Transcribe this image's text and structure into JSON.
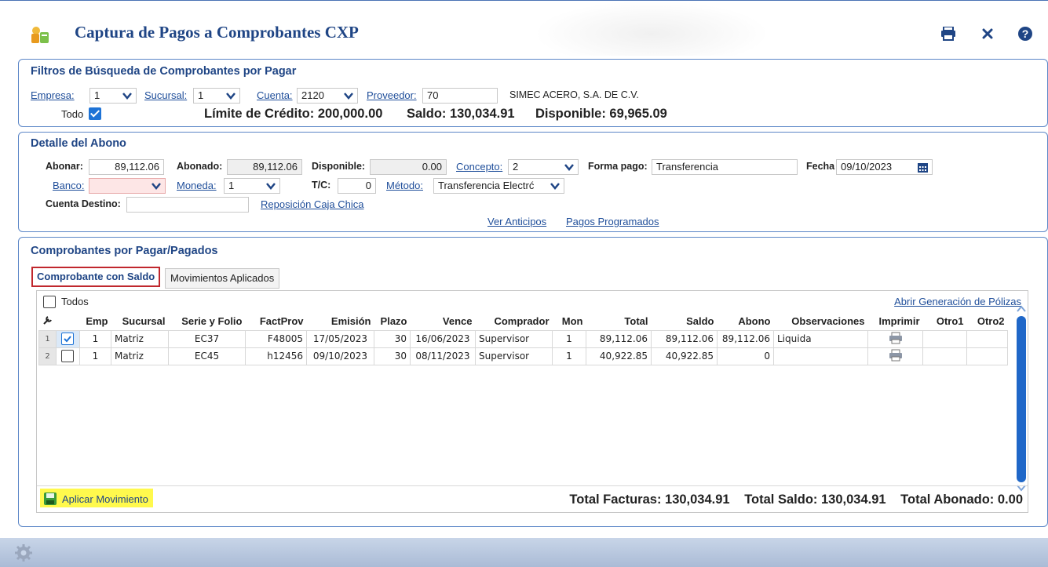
{
  "header": {
    "title": "Captura de Pagos a Comprobantes CXP",
    "actions": [
      "print-icon",
      "close-icon",
      "help-icon"
    ]
  },
  "filters": {
    "title": "Filtros de Búsqueda de Comprobantes por Pagar",
    "empresa_label": "Empresa:",
    "empresa_value": "1",
    "sucursal_label": "Sucursal:",
    "sucursal_value": "1",
    "cuenta_label": "Cuenta:",
    "cuenta_value": "2120",
    "proveedor_label": "Proveedor:",
    "proveedor_value": "70",
    "proveedor_name": "SIMEC ACERO, S.A. DE C.V.",
    "todo_label": "Todo",
    "limite_text": "Límite de Crédito: 200,000.00",
    "saldo_text": "Saldo: 130,034.91",
    "disponible_text": "Disponible: 69,965.09"
  },
  "detalle": {
    "title": "Detalle del Abono",
    "abonar_label": "Abonar:",
    "abonar_value": "89,112.06",
    "abonado_label": "Abonado:",
    "abonado_value": "89,112.06",
    "disponible_label": "Disponible:",
    "disponible_value": "0.00",
    "concepto_label": "Concepto:",
    "concepto_value": "2",
    "forma_pago_label": "Forma pago:",
    "forma_pago_value": "Transferencia",
    "fecha_label": "Fecha",
    "fecha_value": "09/10/2023",
    "banco_label": "Banco:",
    "banco_value": "",
    "moneda_label": "Moneda:",
    "moneda_value": "1",
    "tc_label": "T/C:",
    "tc_value": "0",
    "metodo_label": "Método:",
    "metodo_value": "Transferencia Electrć",
    "cuenta_destino_label": "Cuenta Destino:",
    "cuenta_destino_value": "",
    "reposicion_link": "Reposición Caja Chica",
    "ver_anticipos_link": "Ver Anticipos",
    "pagos_programados_link": "Pagos Programados"
  },
  "comprobantes": {
    "title": "Comprobantes por Pagar/Pagados",
    "tabs": [
      {
        "label": "Comprobante con Saldo",
        "active": true
      },
      {
        "label": "Movimientos Aplicados",
        "active": false
      }
    ],
    "todos_label": "Todos",
    "polizas_link": "Abrir Generación de Pólizas",
    "columns": [
      "Emp",
      "Sucursal",
      "Serie y Folio",
      "FactProv",
      "Emisión",
      "Plazo",
      "Vence",
      "Comprador",
      "Mon",
      "Total",
      "Saldo",
      "Abono",
      "Observaciones",
      "Imprimir",
      "Otro1",
      "Otro2"
    ],
    "rows": [
      {
        "n": "1",
        "checked": true,
        "emp": "1",
        "sucursal": "Matriz",
        "serie": "EC37",
        "factprov": "F48005",
        "emision": "17/05/2023",
        "plazo": "30",
        "vence": "16/06/2023",
        "comprador": "Supervisor",
        "mon": "1",
        "total": "89,112.06",
        "saldo": "89,112.06",
        "abono": "89,112.06",
        "observaciones": "Liquida"
      },
      {
        "n": "2",
        "checked": false,
        "emp": "1",
        "sucursal": "Matriz",
        "serie": "EC45",
        "factprov": "h12456",
        "emision": "09/10/2023",
        "plazo": "30",
        "vence": "08/11/2023",
        "comprador": "Supervisor",
        "mon": "1",
        "total": "40,922.85",
        "saldo": "40,922.85",
        "abono": "0",
        "observaciones": ""
      }
    ],
    "aplicar_label": "Aplicar Movimiento",
    "total_facturas": "Total Facturas: 130,034.91",
    "total_saldo": "Total Saldo: 130,034.91",
    "total_abonado": "Total Abonado: 0.00"
  },
  "colors": {
    "accent": "#1f4585",
    "link": "#1f4e9a",
    "panel_border": "#5b86c7",
    "tab_highlight": "#c0272d",
    "apply_highlight": "#fff94d",
    "checkbox": "#1e73d6"
  }
}
